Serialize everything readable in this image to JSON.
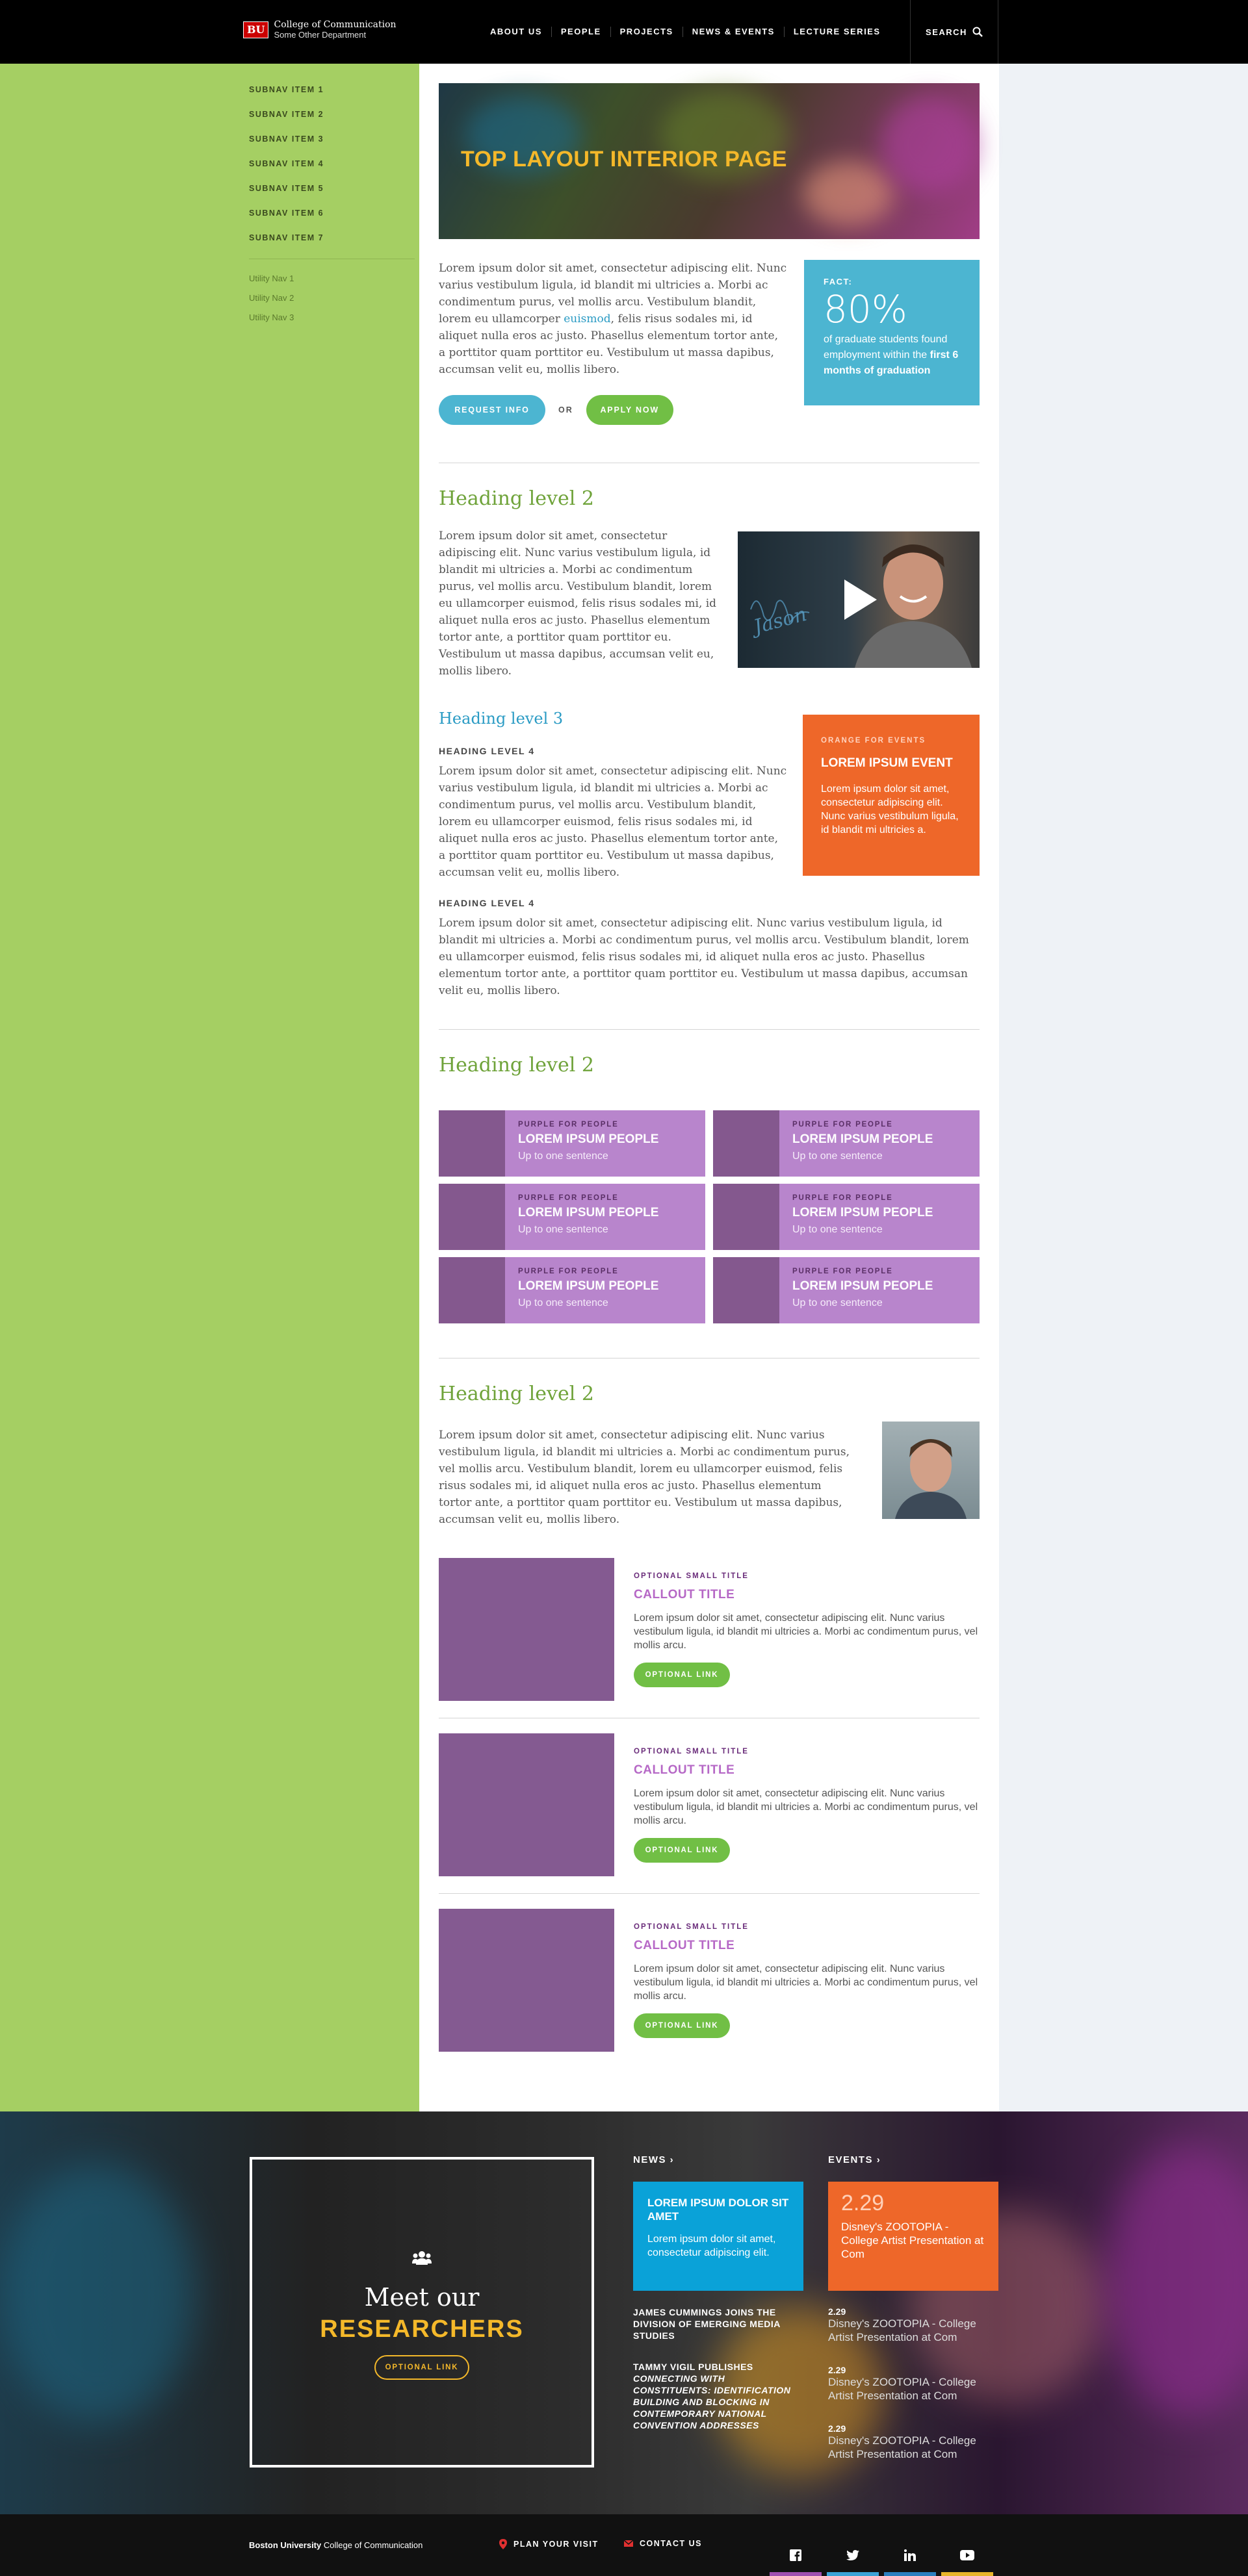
{
  "header": {
    "logo_mark": "BU",
    "college": "College of Communication",
    "department": "Some Other Department",
    "nav": [
      "ABOUT US",
      "PEOPLE",
      "PROJECTS",
      "NEWS & EVENTS",
      "LECTURE SERIES"
    ],
    "search_label": "SEARCH"
  },
  "sidebar": {
    "subnav": [
      "SUBNAV ITEM 1",
      "SUBNAV ITEM 2",
      "SUBNAV ITEM 3",
      "SUBNAV ITEM 4",
      "SUBNAV ITEM 5",
      "SUBNAV ITEM 6",
      "SUBNAV ITEM 7"
    ],
    "utility": [
      "Utility Nav 1",
      "Utility Nav 2",
      "Utility Nav 3"
    ]
  },
  "hero": {
    "title": "TOP LAYOUT INTERIOR PAGE"
  },
  "intro": {
    "text_before": "Lorem ipsum dolor sit amet, consectetur adipiscing elit. Nunc varius vestibulum ligula, id blandit mi ultricies a. Morbi ac condimentum purus, vel mollis arcu. Vestibulum blandit, lorem eu ullamcorper ",
    "link": "euismod",
    "text_after": ", felis risus sodales mi, id aliquet nulla eros ac justo. Phasellus elementum tortor ante, a porttitor quam porttitor eu. Vestibulum ut massa dapibus, accumsan velit eu, mollis libero.",
    "request_button": "REQUEST INFO",
    "or": "OR",
    "apply_button": "APPLY NOW"
  },
  "fact": {
    "label": "FACT:",
    "number": "80%",
    "text": "of graduate students found employment within the ",
    "text_bold": "first 6 months of graduation"
  },
  "section1": {
    "h2": "Heading level 2",
    "para": "Lorem ipsum dolor sit amet, consectetur adipiscing elit. Nunc varius vestibulum ligula, id blandit mi ultricies a. Morbi ac condimentum purus, vel mollis arcu. Vestibulum blandit, lorem eu ullamcorper euismod, felis risus sodales mi, id aliquet nulla eros ac justo. Phasellus elementum tortor ante, a porttitor quam porttitor eu. Vestibulum ut massa dapibus, accumsan velit eu, mollis libero.",
    "video_caption": "Jason",
    "h3": "Heading level 3",
    "h4a": "HEADING LEVEL 4",
    "para2": "Lorem ipsum dolor sit amet, consectetur adipiscing elit. Nunc varius vestibulum ligula, id blandit mi ultricies a. Morbi ac condimentum purus, vel mollis arcu. Vestibulum blandit, lorem eu ullamcorper euismod, felis risus sodales mi, id aliquet nulla eros ac justo. Phasellus elementum tortor ante, a porttitor quam porttitor eu. Vestibulum ut massa dapibus, accumsan velit eu, mollis libero.",
    "h4b": "HEADING LEVEL 4",
    "para3": "Lorem ipsum dolor sit amet, consectetur adipiscing elit. Nunc varius vestibulum ligula, id blandit mi ultricies a. Morbi ac condimentum purus, vel mollis arcu. Vestibulum blandit, lorem eu ullamcorper euismod, felis risus sodales mi, id aliquet nulla eros ac justo. Phasellus elementum tortor ante, a porttitor quam porttitor eu. Vestibulum ut massa dapibus, accumsan velit eu, mollis libero."
  },
  "event_box": {
    "label": "ORANGE FOR EVENTS",
    "title": "LOREM IPSUM EVENT",
    "text": "Lorem ipsum dolor sit amet, consectetur adipiscing elit. Nunc varius vestibulum ligula, id blandit mi ultricies a."
  },
  "section2": {
    "h2": "Heading level 2",
    "people": [
      {
        "label": "PURPLE FOR PEOPLE",
        "title": "LOREM IPSUM PEOPLE",
        "sub": "Up to one sentence"
      },
      {
        "label": "PURPLE FOR PEOPLE",
        "title": "LOREM IPSUM PEOPLE",
        "sub": "Up to one sentence"
      },
      {
        "label": "PURPLE FOR PEOPLE",
        "title": "LOREM IPSUM PEOPLE",
        "sub": "Up to one sentence"
      },
      {
        "label": "PURPLE FOR PEOPLE",
        "title": "LOREM IPSUM PEOPLE",
        "sub": "Up to one sentence"
      },
      {
        "label": "PURPLE FOR PEOPLE",
        "title": "LOREM IPSUM PEOPLE",
        "sub": "Up to one sentence"
      },
      {
        "label": "PURPLE FOR PEOPLE",
        "title": "LOREM IPSUM PEOPLE",
        "sub": "Up to one sentence"
      }
    ]
  },
  "section3": {
    "h2": "Heading level 2",
    "para": "Lorem ipsum dolor sit amet, consectetur adipiscing elit. Nunc varius vestibulum ligula, id blandit mi ultricies a. Morbi ac condimentum purus, vel mollis arcu. Vestibulum blandit, lorem eu ullamcorper euismod, felis risus sodales mi, id aliquet nulla eros ac justo. Phasellus elementum tortor ante, a porttitor quam porttitor eu. Vestibulum ut massa dapibus, accumsan velit eu, mollis libero.",
    "callouts": [
      {
        "label": "OPTIONAL SMALL TITLE",
        "title": "CALLOUT TITLE",
        "text": "Lorem ipsum dolor sit amet, consectetur adipiscing elit. Nunc varius vestibulum ligula, id blandit mi ultricies a. Morbi ac condimentum purus, vel mollis arcu.",
        "link": "OPTIONAL LINK"
      },
      {
        "label": "OPTIONAL SMALL TITLE",
        "title": "CALLOUT TITLE",
        "text": "Lorem ipsum dolor sit amet, consectetur adipiscing elit. Nunc varius vestibulum ligula, id blandit mi ultricies a. Morbi ac condimentum purus, vel mollis arcu.",
        "link": "OPTIONAL LINK"
      },
      {
        "label": "OPTIONAL SMALL TITLE",
        "title": "CALLOUT TITLE",
        "text": "Lorem ipsum dolor sit amet, consectetur adipiscing elit. Nunc varius vestibulum ligula, id blandit mi ultricies a. Morbi ac condimentum purus, vel mollis arcu.",
        "link": "OPTIONAL LINK"
      }
    ]
  },
  "footer": {
    "meet": "Meet our",
    "researchers": "RESEARCHERS",
    "researchers_link": "OPTIONAL LINK",
    "news_heading": "NEWS",
    "news_box_title": "LOREM IPSUM DOLOR SIT AMET",
    "news_box_text": "Lorem ipsum dolor sit amet, consectetur adipiscing elit.",
    "news1": "JAMES CUMMINGS JOINS THE DIVISION OF EMERGING MEDIA STUDIES",
    "news2_a": "TAMMY VIGIL PUBLISHES ",
    "news2_b": "CONNECTING WITH CONSTITUENTS: IDENTIFICATION BUILDING AND BLOCKING IN CONTEMPORARY NATIONAL CONVENTION ADDRESSES",
    "events_heading": "EVENTS",
    "event_box_date": "2.29",
    "event_box_text": "Disney's ZOOTOPIA - College Artist Presentation at Com",
    "events": [
      {
        "date": "2.29",
        "text": "Disney's ZOOTOPIA - College Artist Presentation at Com"
      },
      {
        "date": "2.29",
        "text": "Disney's ZOOTOPIA - College Artist Presentation at Com"
      },
      {
        "date": "2.29",
        "text": "Disney's ZOOTOPIA - College Artist Presentation at Com"
      }
    ],
    "bottom_bu": "Boston University",
    "bottom_college": " College of Communication",
    "plan_visit": "PLAN YOUR VISIT",
    "contact": "CONTACT US",
    "social": [
      "facebook-icon",
      "twitter-icon",
      "linkedin-icon",
      "youtube-icon"
    ],
    "social_bar_colors": [
      "#a04fb0",
      "#3ba3d6",
      "#2a7fbf",
      "#e8b52a"
    ]
  },
  "colors": {
    "green": "#a5cf63",
    "blue": "#4cb5d1",
    "orange": "#ee6729",
    "purple": "#b885cc",
    "gold": "#f4b82a",
    "cta_green": "#71bf45"
  }
}
